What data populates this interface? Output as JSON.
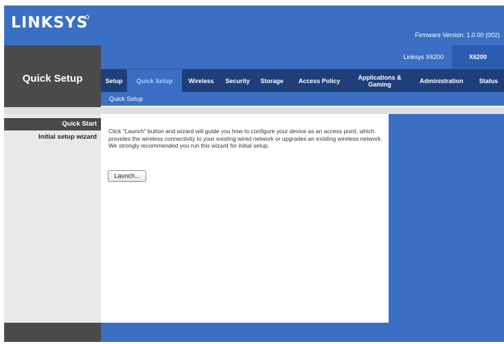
{
  "header": {
    "logo": "LINKSYS",
    "firmware": "Firmware Version: 1.0.00 (002)"
  },
  "model": {
    "name": "Linksys X6200",
    "badge": "X6200"
  },
  "section_title": "Quick Setup",
  "tabs": [
    {
      "label": "Setup"
    },
    {
      "label": "Quick Setup"
    },
    {
      "label": "Wireless"
    },
    {
      "label": "Security"
    },
    {
      "label": "Storage"
    },
    {
      "label": "Access Policy"
    },
    {
      "label": "Applications & Gaming"
    },
    {
      "label": "Administration"
    },
    {
      "label": "Status"
    }
  ],
  "subtab": "Quick Setup",
  "sidebar": {
    "active": "Quick Start",
    "item": "Initial setup wizard"
  },
  "content": {
    "description": "Click \"Launch\" button and wizard will guide you how to configure your device as an access point, which provides the wireless connectivity to your existing wired network or upgrades an existing wireless network. We strongly recommended you run this wizard for initial setup.",
    "launch_label": "Launch..."
  },
  "colors": {
    "brand_blue": "#3a6fc4",
    "dark_tab": "#1f3f7a",
    "dark_gray": "#4a4a4a",
    "active_tab_text": "#9fd0ff"
  }
}
